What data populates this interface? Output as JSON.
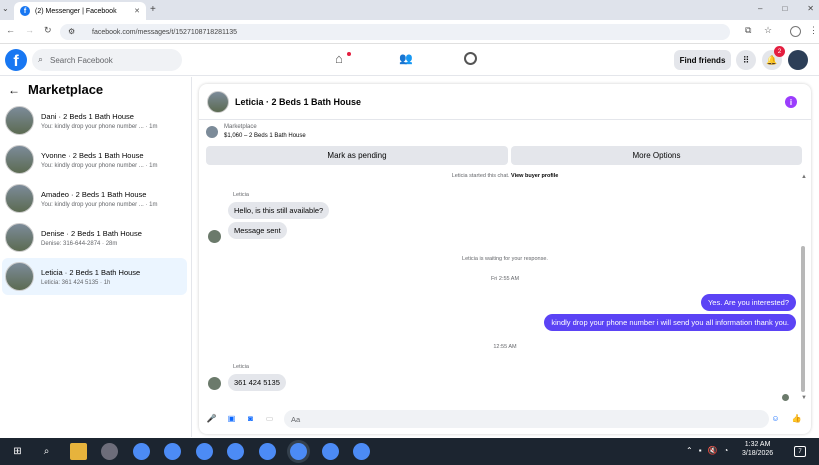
{
  "browser": {
    "tab_title": "(2) Messenger | Facebook",
    "new_tab": "+",
    "url": "facebook.com/messages/t/1527108718281135",
    "window_controls": [
      "–",
      "□",
      "✕"
    ]
  },
  "fb": {
    "search_placeholder": "Search Facebook",
    "find_friends": "Find friends",
    "notif_count": "2"
  },
  "sidebar": {
    "title": "Marketplace",
    "conversations": [
      {
        "name": "Dani · 2 Beds 1 Bath House",
        "preview": "You: kindly drop your phone number ... · 1m"
      },
      {
        "name": "Yvonne · 2 Beds 1 Bath House",
        "preview": "You: kindly drop your phone number ... · 1m"
      },
      {
        "name": "Amadeo · 2 Beds 1 Bath House",
        "preview": "You: kindly drop your phone number ... · 1m"
      },
      {
        "name": "Denise · 2 Beds 1 Bath House",
        "preview": "Denise: 316-644-2874 · 28m"
      },
      {
        "name": "Leticia · 2 Beds 1 Bath House",
        "preview": "Leticia: 361 424 5135 · 1h"
      }
    ]
  },
  "chat": {
    "title": "Leticia · 2 Beds 1 Bath House",
    "mp_label": "Marketplace",
    "mp_listing": "$1,060 – 2 Beds 1 Bath House",
    "mark_pending": "Mark as pending",
    "more_options": "More Options",
    "started_text": "Leticia started this chat.",
    "view_buyer": "View buyer profile",
    "sender1": "Leticia",
    "msg1": "Hello, is this still available?",
    "msg2": "Message sent",
    "waiting": "Leticia is waiting for your response.",
    "time1": "Fri 2:55 AM",
    "out1": "Yes. Are you interested?",
    "out2": "kindly drop your phone number i will send you all information thank you.",
    "time2": "12:55 AM",
    "sender2": "Leticia",
    "msg3": "361 424 5135",
    "input_placeholder": "Aa"
  },
  "taskbar": {
    "time": "1:32 AM",
    "date": "3/18/2026",
    "notif": "7"
  },
  "colors": {
    "fb_blue": "#1877f2",
    "bubble_out": "#5b43f5",
    "accent_purple": "#9b3dfd"
  }
}
